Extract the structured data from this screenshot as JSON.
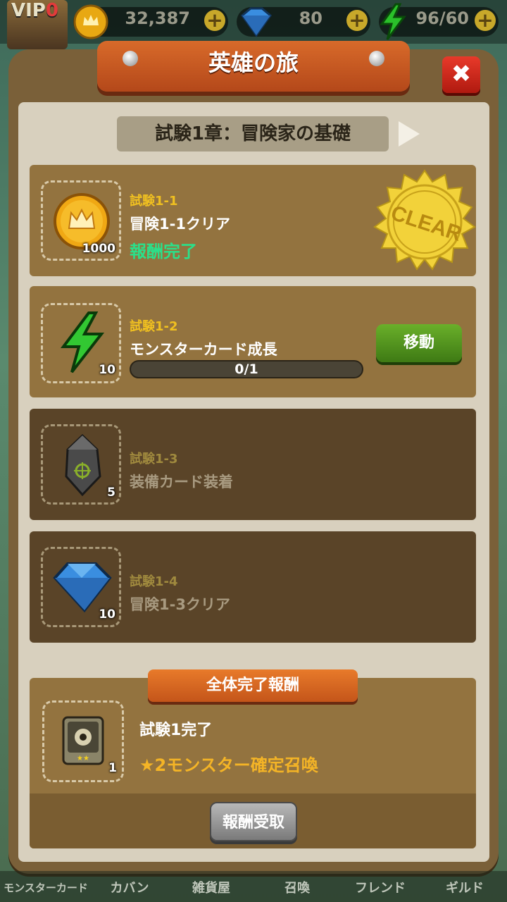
{
  "top_bar": {
    "vip_label": "VIP",
    "vip_level": "0",
    "gold": "32,387",
    "gems": "80",
    "energy": "96/60"
  },
  "dialog": {
    "title": "英雄の旅",
    "close_label": "✖",
    "chapter": "試験1章：冒険家の基礎",
    "clear_stamp": "CLEAR"
  },
  "quests": [
    {
      "id": "試験1-1",
      "name": "冒険1-1クリア",
      "status": "報酬完了",
      "reward_qty": "1000",
      "reward_icon": "gold-coin-icon"
    },
    {
      "id": "試験1-2",
      "name": "モンスターカード成長",
      "progress_text": "0/1",
      "progress_fraction": 0,
      "button": "移動",
      "reward_qty": "10",
      "reward_icon": "energy-bolt-icon"
    },
    {
      "id": "試験1-3",
      "name": "装備カード装着",
      "reward_qty": "5",
      "reward_icon": "equipment-stone-icon"
    },
    {
      "id": "試験1-4",
      "name": "冒険1-3クリア",
      "reward_qty": "10",
      "reward_icon": "gem-icon"
    }
  ],
  "completion_reward": {
    "banner": "全体完了報酬",
    "title": "試験1完了",
    "description": "★2モンスター確定召喚",
    "reward_qty": "1",
    "button": "報酬受取"
  },
  "bottom_nav": [
    "モンスターカード",
    "カバン",
    "雑貨屋",
    "召喚",
    "フレンド",
    "ギルド"
  ],
  "colors": {
    "panel": "#7a6039",
    "accent_orange": "#c4551a",
    "complete_green": "#2ae08a",
    "quest_id_yellow": "#f0c020",
    "reward_orange": "#f4b426"
  }
}
